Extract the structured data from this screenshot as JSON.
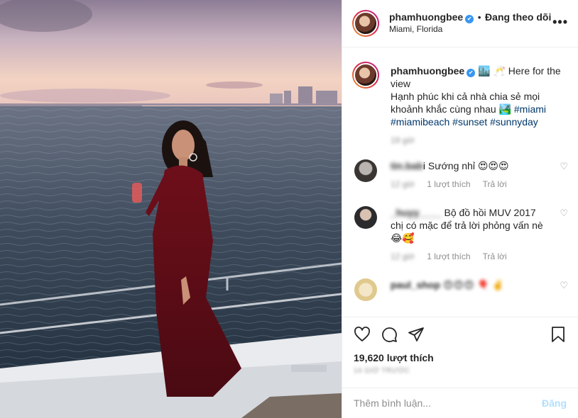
{
  "header": {
    "username": "phamhuongbee",
    "separator": "•",
    "follow_status": "Đang theo dõi",
    "location": "Miami, Florida",
    "more_icon": "more-horizontal-icon"
  },
  "caption": {
    "username": "phamhuongbee",
    "text_line1": "🏙️ 🥂 Here for the view",
    "text_line2": "Hạnh phúc khi cả nhà chia sẻ mọi khoảnh khắc cùng nhau 🏞️ ",
    "hashtags": [
      "#miami",
      "#miamibeach",
      "#sunset",
      "#sunnyday"
    ],
    "time": "19 giờ"
  },
  "comments": [
    {
      "username": "tin.bab",
      "text": "i Sướng nhỉ 😍😍😍",
      "time": "12 giờ",
      "likes": "1 lượt thích",
      "reply": "Trả lời"
    },
    {
      "username": "_huyy____",
      "text": "Bộ đồ hồi MUV 2017 chị có mặc để trả lời phỏng vấn nè 😂🥰",
      "time": "12 giờ",
      "likes": "1 lượt thích",
      "reply": "Trả lời"
    },
    {
      "username": "paul_shop",
      "text": "😍😍😍 🎈 ✌️",
      "time": "",
      "likes": "",
      "reply": ""
    }
  ],
  "actions": {
    "like_icon": "heart-icon",
    "comment_icon": "comment-icon",
    "share_icon": "send-icon",
    "save_icon": "bookmark-icon",
    "likes_count": "19,620 lượt thích",
    "post_date": "14 GIỜ TRƯỚC"
  },
  "comment_box": {
    "placeholder": "Thêm bình luận...",
    "post_label": "Đăng"
  },
  "colors": {
    "link": "#00376b",
    "verified": "#3897f0",
    "muted": "#8e8e8e",
    "post_button": "#b2dffc",
    "border": "#efefef"
  }
}
